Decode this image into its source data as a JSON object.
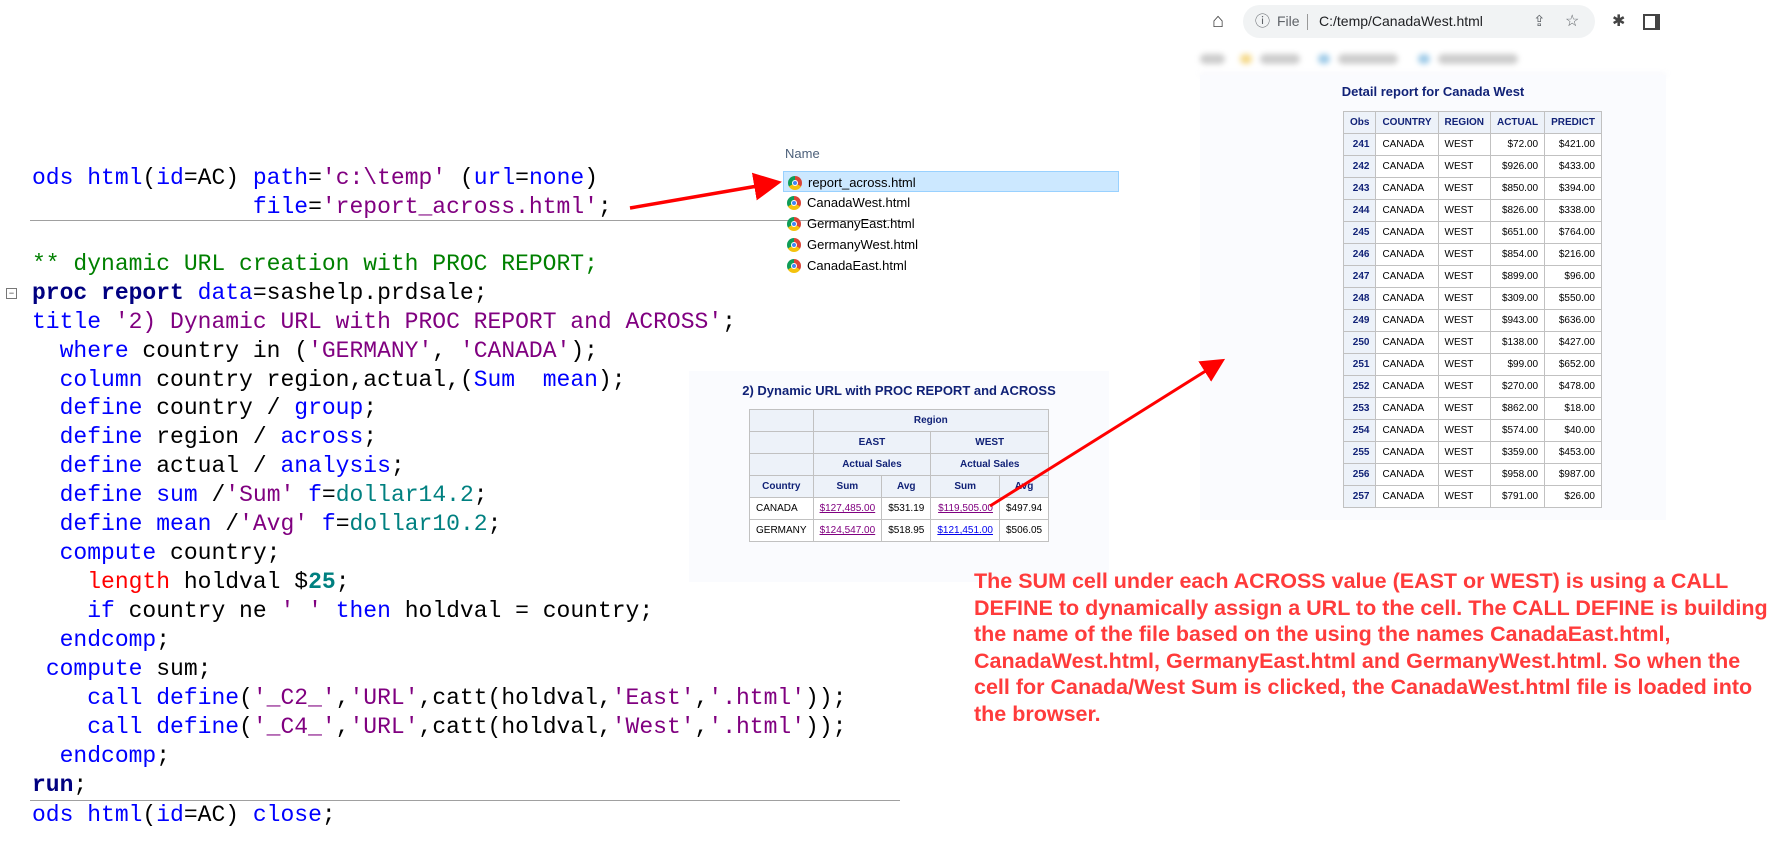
{
  "code": {
    "lines": [
      [
        [
          "kw",
          "ods html"
        ],
        [
          "txt",
          "("
        ],
        [
          "kw",
          "id"
        ],
        [
          "txt",
          "=AC) "
        ],
        [
          "kw",
          "path"
        ],
        [
          "txt",
          "="
        ],
        [
          "str",
          "'c:\\temp'"
        ],
        [
          "txt",
          " ("
        ],
        [
          "kw",
          "url"
        ],
        [
          "txt",
          "="
        ],
        [
          "kw",
          "none"
        ],
        [
          "txt",
          ")"
        ]
      ],
      [
        [
          "txt",
          "                "
        ],
        [
          "kw",
          "file"
        ],
        [
          "txt",
          "="
        ],
        [
          "str",
          "'report_across.html'"
        ],
        [
          "txt",
          ";"
        ]
      ],
      [
        [
          "cm",
          "** dynamic URL creation with PROC REPORT;"
        ]
      ],
      [
        [
          "bold",
          "proc report"
        ],
        [
          "txt",
          " "
        ],
        [
          "kw",
          "data"
        ],
        [
          "txt",
          "=sashelp.prdsale;"
        ]
      ],
      [
        [
          "kw",
          "title"
        ],
        [
          "txt",
          " "
        ],
        [
          "str",
          "'2) Dynamic URL with PROC REPORT and ACROSS'"
        ],
        [
          "txt",
          ";"
        ]
      ],
      [
        [
          "txt",
          "  "
        ],
        [
          "kw",
          "where"
        ],
        [
          "txt",
          " country in ("
        ],
        [
          "str",
          "'GERMANY'"
        ],
        [
          "txt",
          ", "
        ],
        [
          "str",
          "'CANADA'"
        ],
        [
          "txt",
          ");"
        ]
      ],
      [
        [
          "txt",
          "  "
        ],
        [
          "kw",
          "column"
        ],
        [
          "txt",
          " country region,actual,("
        ],
        [
          "kw",
          "Sum"
        ],
        [
          "txt",
          "  "
        ],
        [
          "kw",
          "mean"
        ],
        [
          "txt",
          ");"
        ]
      ],
      [
        [
          "txt",
          "  "
        ],
        [
          "kw",
          "define"
        ],
        [
          "txt",
          " country / "
        ],
        [
          "kw",
          "group"
        ],
        [
          "txt",
          ";"
        ]
      ],
      [
        [
          "txt",
          "  "
        ],
        [
          "kw",
          "define"
        ],
        [
          "txt",
          " region / "
        ],
        [
          "kw",
          "across"
        ],
        [
          "txt",
          ";"
        ]
      ],
      [
        [
          "txt",
          "  "
        ],
        [
          "kw",
          "define"
        ],
        [
          "txt",
          " actual / "
        ],
        [
          "kw",
          "analysis"
        ],
        [
          "txt",
          ";"
        ]
      ],
      [
        [
          "txt",
          "  "
        ],
        [
          "kw",
          "define"
        ],
        [
          "txt",
          " "
        ],
        [
          "kw",
          "sum"
        ],
        [
          "txt",
          " /"
        ],
        [
          "str",
          "'Sum'"
        ],
        [
          "txt",
          " "
        ],
        [
          "kw",
          "f"
        ],
        [
          "txt",
          "="
        ],
        [
          "num",
          "dollar14.2"
        ],
        [
          "txt",
          ";"
        ]
      ],
      [
        [
          "txt",
          "  "
        ],
        [
          "kw",
          "define"
        ],
        [
          "txt",
          " "
        ],
        [
          "kw",
          "mean"
        ],
        [
          "txt",
          " /"
        ],
        [
          "str",
          "'Avg'"
        ],
        [
          "txt",
          " "
        ],
        [
          "kw",
          "f"
        ],
        [
          "txt",
          "="
        ],
        [
          "num",
          "dollar10.2"
        ],
        [
          "txt",
          ";"
        ]
      ],
      [
        [
          "txt",
          "  "
        ],
        [
          "kw",
          "compute"
        ],
        [
          "txt",
          " country;"
        ]
      ],
      [
        [
          "txt",
          "    "
        ],
        [
          "red",
          "length"
        ],
        [
          "txt",
          " holdval $"
        ],
        [
          "numb",
          "25"
        ],
        [
          "txt",
          ";"
        ]
      ],
      [
        [
          "txt",
          "    "
        ],
        [
          "kw",
          "if"
        ],
        [
          "txt",
          " country ne "
        ],
        [
          "str",
          "' '"
        ],
        [
          "txt",
          " "
        ],
        [
          "kw",
          "then"
        ],
        [
          "txt",
          " holdval = country;"
        ]
      ],
      [
        [
          "txt",
          "  "
        ],
        [
          "kw",
          "endcomp"
        ],
        [
          "txt",
          ";"
        ]
      ],
      [
        [
          "txt",
          " "
        ],
        [
          "kw",
          "compute"
        ],
        [
          "txt",
          " sum;"
        ]
      ],
      [
        [
          "txt",
          "    "
        ],
        [
          "kw",
          "call define"
        ],
        [
          "txt",
          "("
        ],
        [
          "str",
          "'_C2_'"
        ],
        [
          "txt",
          ","
        ],
        [
          "str",
          "'URL'"
        ],
        [
          "txt",
          ",catt(holdval,"
        ],
        [
          "str",
          "'East'"
        ],
        [
          "txt",
          ","
        ],
        [
          "str",
          "'.html'"
        ],
        [
          "txt",
          "));"
        ]
      ],
      [
        [
          "txt",
          "    "
        ],
        [
          "kw",
          "call define"
        ],
        [
          "txt",
          "("
        ],
        [
          "str",
          "'_C4_'"
        ],
        [
          "txt",
          ","
        ],
        [
          "str",
          "'URL'"
        ],
        [
          "txt",
          ",catt(holdval,"
        ],
        [
          "str",
          "'West'"
        ],
        [
          "txt",
          ","
        ],
        [
          "str",
          "'.html'"
        ],
        [
          "txt",
          "));"
        ]
      ],
      [
        [
          "txt",
          "  "
        ],
        [
          "kw",
          "endcomp"
        ],
        [
          "txt",
          ";"
        ]
      ],
      [
        [
          "bold",
          "run"
        ],
        [
          "txt",
          ";"
        ]
      ],
      [
        [
          "kw",
          "ods html"
        ],
        [
          "txt",
          "("
        ],
        [
          "kw",
          "id"
        ],
        [
          "txt",
          "=AC) "
        ],
        [
          "kw",
          "close"
        ],
        [
          "txt",
          ";"
        ]
      ]
    ]
  },
  "explorer": {
    "header": "Name",
    "files": [
      "report_across.html",
      "CanadaWest.html",
      "GermanyEast.html",
      "GermanyWest.html",
      "CanadaEast.html"
    ],
    "icon": "chrome-icon"
  },
  "summary_report": {
    "title": "2) Dynamic URL with PROC REPORT and ACROSS",
    "region_header": "Region",
    "regions": [
      "EAST",
      "WEST"
    ],
    "measure_header": "Actual Sales",
    "country_header": "Country",
    "sum_header": "Sum",
    "avg_header": "Avg",
    "rows": [
      {
        "country": "CANADA",
        "east_sum": "$127,485.00",
        "east_avg": "$531.19",
        "west_sum": "$119,505.00",
        "west_avg": "$497.94"
      },
      {
        "country": "GERMANY",
        "east_sum": "$124,547.00",
        "east_avg": "$518.95",
        "west_sum": "$121,451.00",
        "west_avg": "$506.05"
      }
    ]
  },
  "browser": {
    "scheme_label": "File",
    "url": "C:/temp/CanadaWest.html",
    "detail_title": "Detail report for Canada West",
    "columns": [
      "Obs",
      "COUNTRY",
      "REGION",
      "ACTUAL",
      "PREDICT"
    ],
    "rows": [
      [
        "241",
        "CANADA",
        "WEST",
        "$72.00",
        "$421.00"
      ],
      [
        "242",
        "CANADA",
        "WEST",
        "$926.00",
        "$433.00"
      ],
      [
        "243",
        "CANADA",
        "WEST",
        "$850.00",
        "$394.00"
      ],
      [
        "244",
        "CANADA",
        "WEST",
        "$826.00",
        "$338.00"
      ],
      [
        "245",
        "CANADA",
        "WEST",
        "$651.00",
        "$764.00"
      ],
      [
        "246",
        "CANADA",
        "WEST",
        "$854.00",
        "$216.00"
      ],
      [
        "247",
        "CANADA",
        "WEST",
        "$899.00",
        "$96.00"
      ],
      [
        "248",
        "CANADA",
        "WEST",
        "$309.00",
        "$550.00"
      ],
      [
        "249",
        "CANADA",
        "WEST",
        "$943.00",
        "$636.00"
      ],
      [
        "250",
        "CANADA",
        "WEST",
        "$138.00",
        "$427.00"
      ],
      [
        "251",
        "CANADA",
        "WEST",
        "$99.00",
        "$652.00"
      ],
      [
        "252",
        "CANADA",
        "WEST",
        "$270.00",
        "$478.00"
      ],
      [
        "253",
        "CANADA",
        "WEST",
        "$862.00",
        "$18.00"
      ],
      [
        "254",
        "CANADA",
        "WEST",
        "$574.00",
        "$40.00"
      ],
      [
        "255",
        "CANADA",
        "WEST",
        "$359.00",
        "$453.00"
      ],
      [
        "256",
        "CANADA",
        "WEST",
        "$958.00",
        "$987.00"
      ],
      [
        "257",
        "CANADA",
        "WEST",
        "$791.00",
        "$26.00"
      ]
    ]
  },
  "annotation": "The SUM cell under each ACROSS value (EAST or WEST)  is using a CALL DEFINE to dynamically assign a URL to the cell. The CALL DEFINE is building the name of the file based on the using the names CanadaEast.html, CanadaWest.html, GermanyEast.html and GermanyWest.html. So when the cell for Canada/West Sum is clicked, the CanadaWest.html file is loaded into the browser.",
  "colors": {
    "arrow": "#ff0000",
    "note": "#ff3b3b",
    "sas_header_text": "#112277"
  }
}
